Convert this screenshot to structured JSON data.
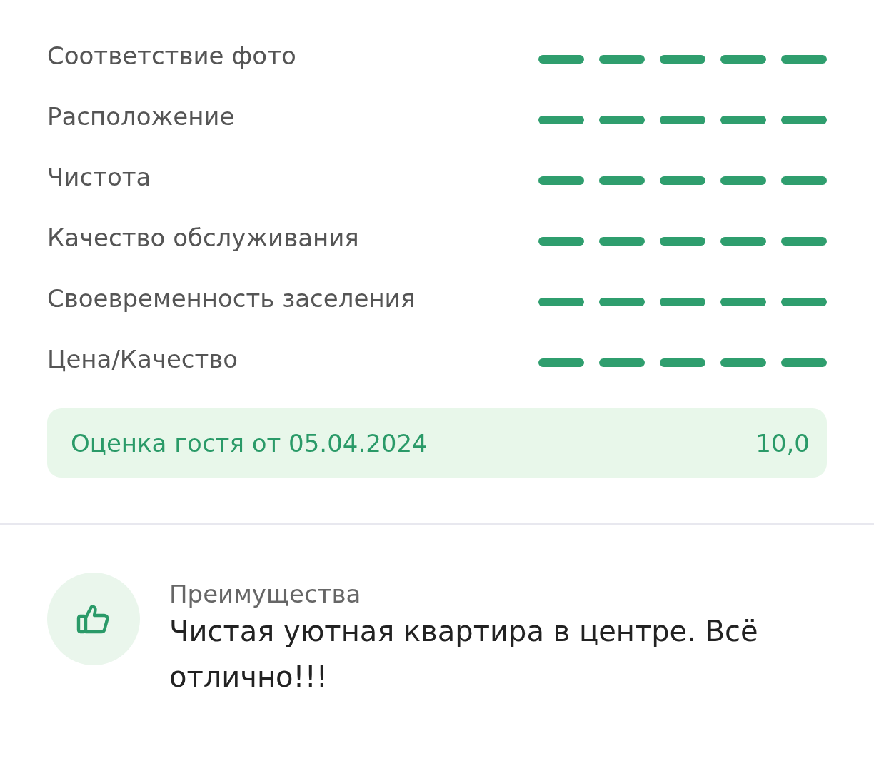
{
  "ratings": [
    {
      "label": "Соответствие фото",
      "stars": 5
    },
    {
      "label": "Расположение",
      "stars": 5
    },
    {
      "label": "Чистота",
      "stars": 5
    },
    {
      "label": "Качество обслуживания",
      "stars": 5
    },
    {
      "label": "Своевременность заселения",
      "stars": 5
    },
    {
      "label": "Цена/Качество",
      "stars": 5
    }
  ],
  "score": {
    "label": "Оценка гостя от 05.04.2024",
    "value": "10,0"
  },
  "advantages": {
    "title": "Преимущества",
    "text": "Чистая уютная квартира в центре. Всё отлично!!!"
  }
}
